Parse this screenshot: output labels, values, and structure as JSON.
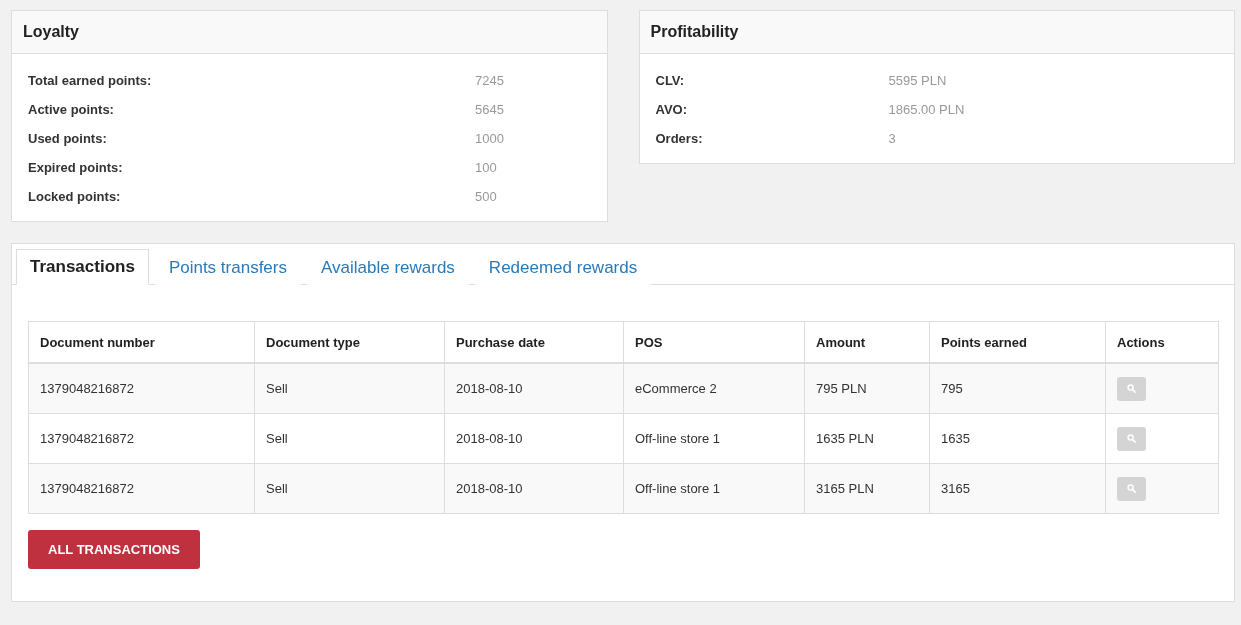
{
  "loyalty": {
    "title": "Loyalty",
    "rows": [
      {
        "label": "Total earned points:",
        "value": "7245"
      },
      {
        "label": "Active points:",
        "value": "5645"
      },
      {
        "label": "Used points:",
        "value": "1000"
      },
      {
        "label": "Expired points:",
        "value": "100"
      },
      {
        "label": "Locked points:",
        "value": "500"
      }
    ]
  },
  "profitability": {
    "title": "Profitability",
    "rows": [
      {
        "label": "CLV:",
        "value": "5595 PLN"
      },
      {
        "label": "AVO:",
        "value": "1865.00 PLN"
      },
      {
        "label": "Orders:",
        "value": "3"
      }
    ]
  },
  "tabs": [
    {
      "label": "Transactions",
      "selected": true
    },
    {
      "label": "Points transfers",
      "selected": false
    },
    {
      "label": "Available rewards",
      "selected": false
    },
    {
      "label": "Redeemed rewards",
      "selected": false
    }
  ],
  "table": {
    "columns": [
      "Document number",
      "Document type",
      "Purchase date",
      "POS",
      "Amount",
      "Points earned",
      "Actions"
    ],
    "rows": [
      [
        "1379048216872",
        "Sell",
        "2018-08-10",
        "eCommerce 2",
        "795 PLN",
        "795"
      ],
      [
        "1379048216872",
        "Sell",
        "2018-08-10",
        "Off-line store 1",
        "1635 PLN",
        "1635"
      ],
      [
        "1379048216872",
        "Sell",
        "2018-08-10",
        "Off-line store 1",
        "3165 PLN",
        "3165"
      ]
    ]
  },
  "button": "ALL TRANSACTIONS"
}
